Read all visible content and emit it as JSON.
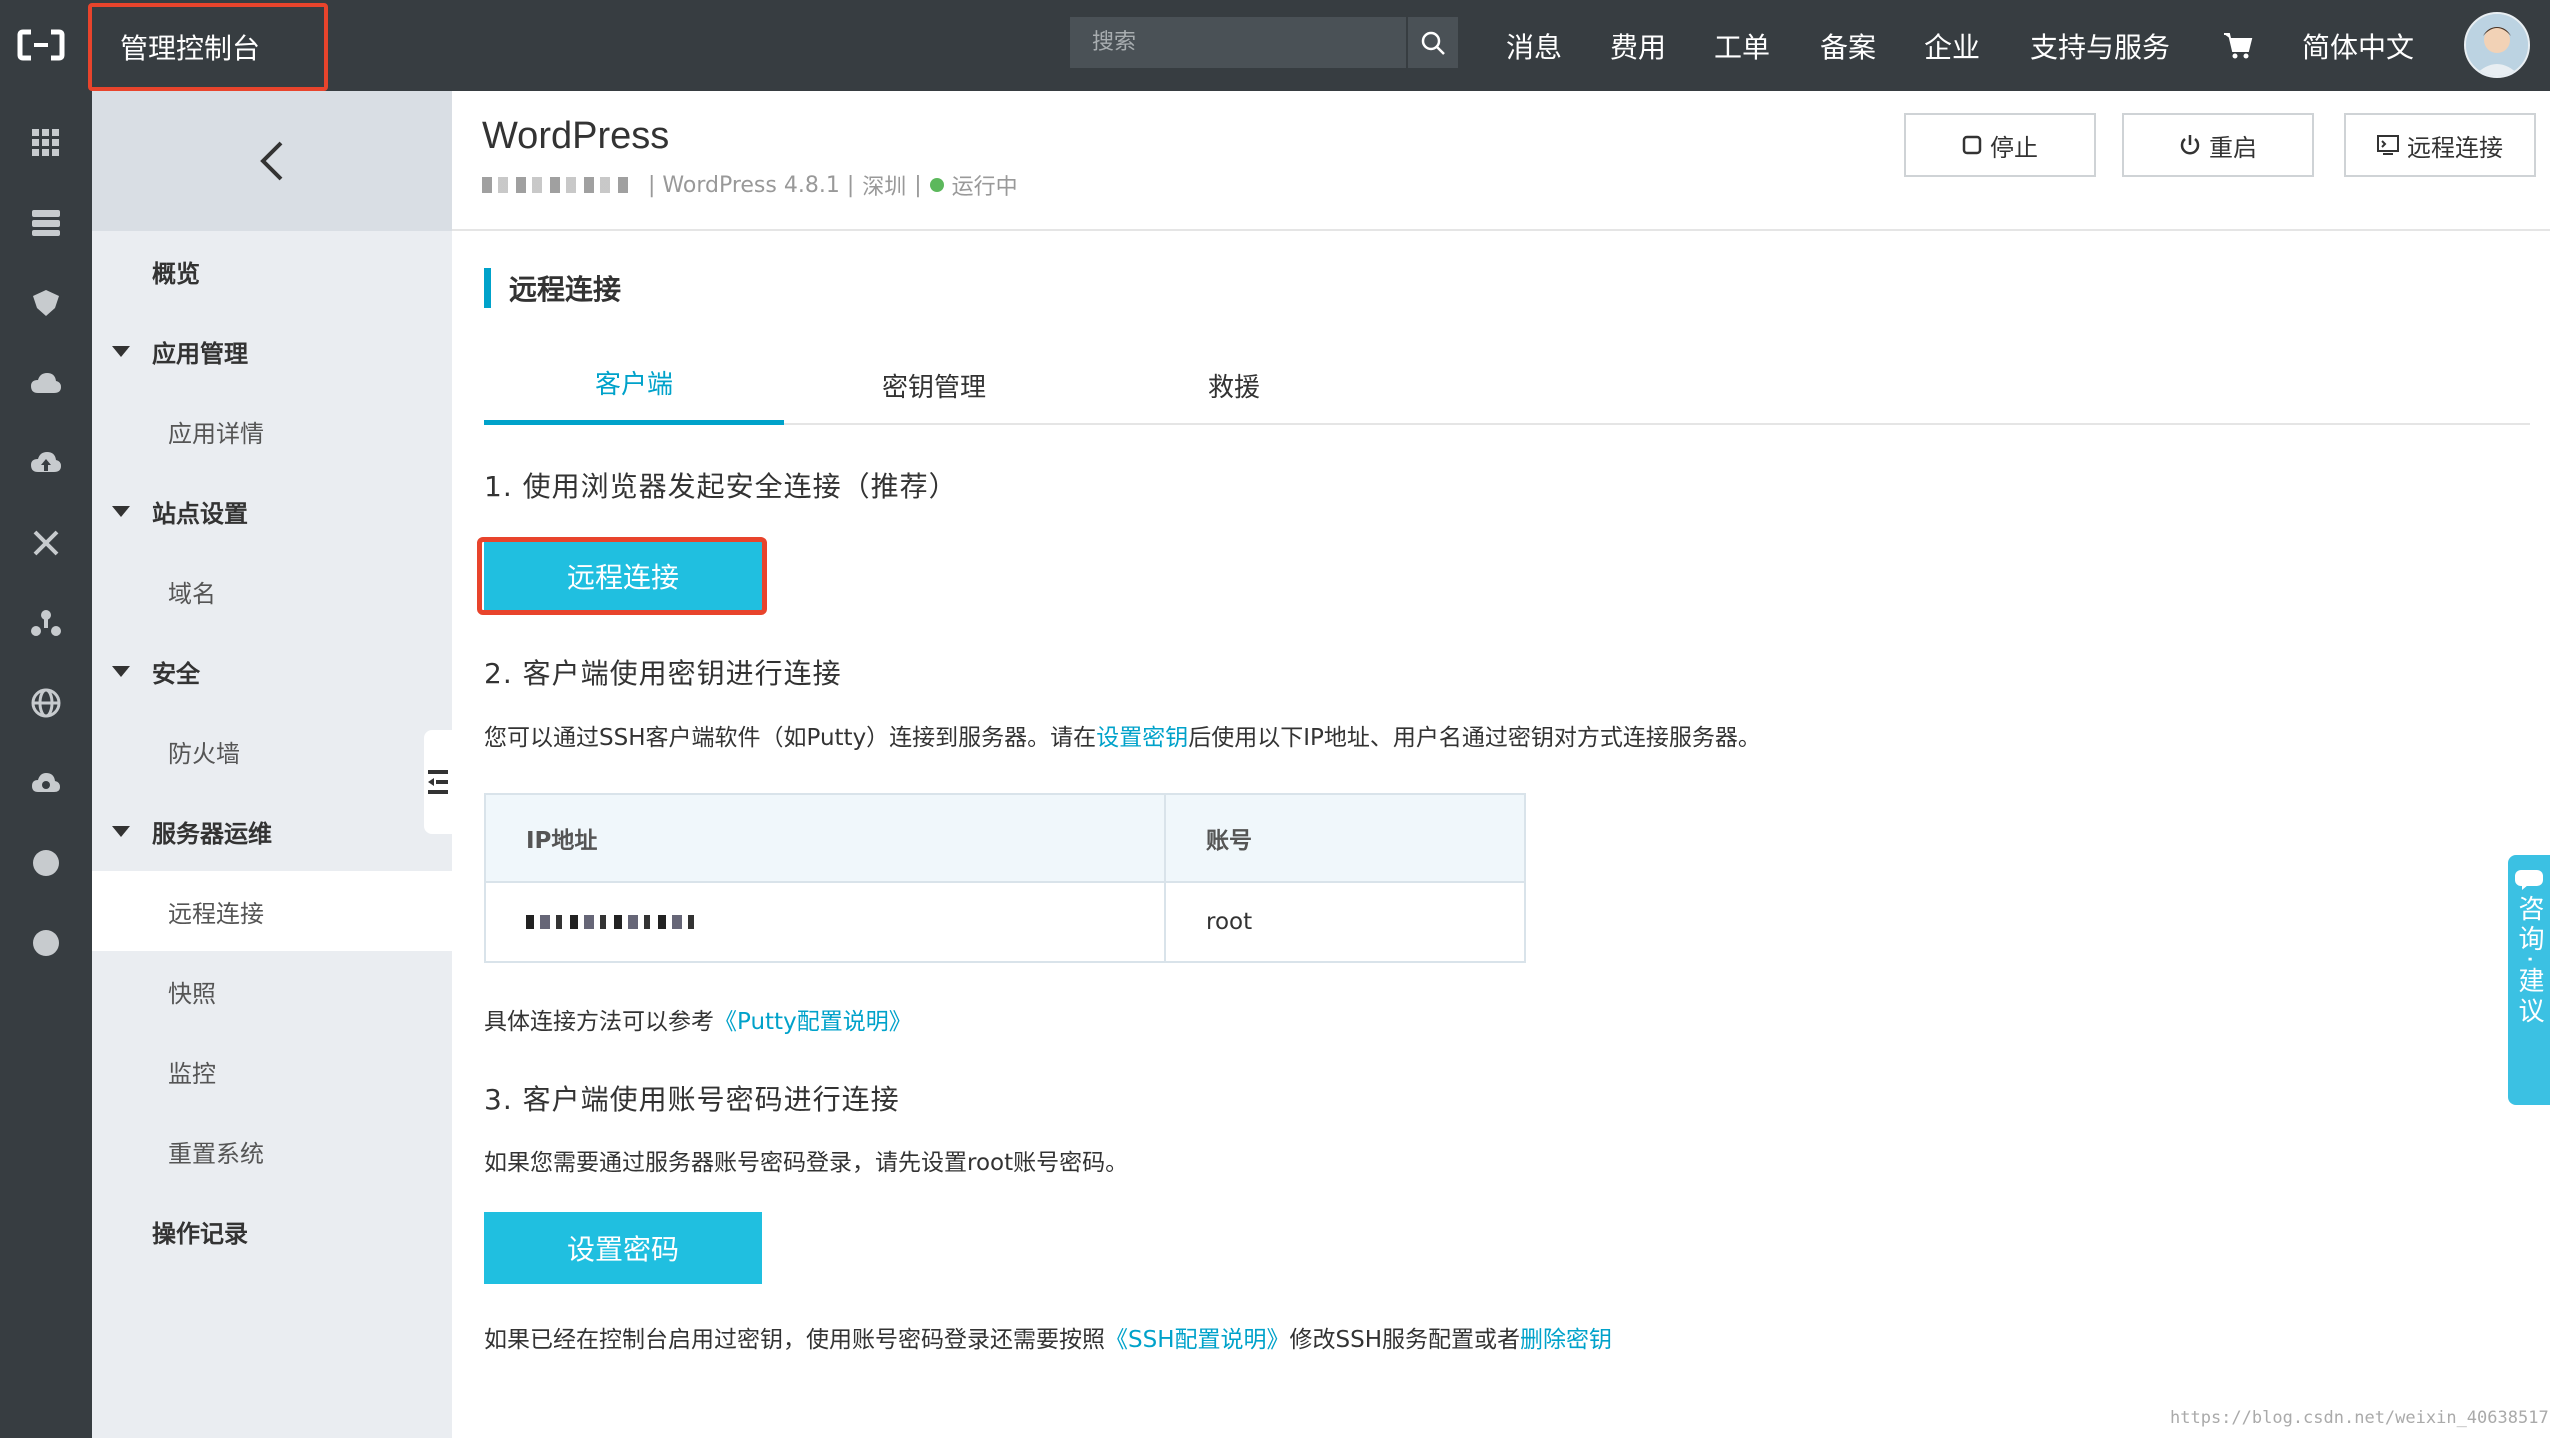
{
  "topbar": {
    "console_title": "管理控制台",
    "search_placeholder": "搜索",
    "nav": [
      "消息",
      "费用",
      "工单",
      "备案",
      "企业",
      "支持与服务",
      "简体中文"
    ]
  },
  "rail_icons": [
    "grid-icon",
    "server-icon",
    "database-icon",
    "cloud-icon",
    "cloud-upload-icon",
    "network-icon",
    "cluster-icon",
    "globe-icon",
    "cloud-sync-icon",
    "circle-icon",
    "circle-icon"
  ],
  "sidebar": {
    "items": [
      {
        "label": "概览",
        "type": "plain"
      },
      {
        "label": "应用管理",
        "type": "group"
      },
      {
        "label": "应用详情",
        "type": "sub"
      },
      {
        "label": "站点设置",
        "type": "group"
      },
      {
        "label": "域名",
        "type": "sub"
      },
      {
        "label": "安全",
        "type": "group"
      },
      {
        "label": "防火墙",
        "type": "sub"
      },
      {
        "label": "服务器运维",
        "type": "group"
      },
      {
        "label": "远程连接",
        "type": "sub",
        "active": true
      },
      {
        "label": "快照",
        "type": "sub"
      },
      {
        "label": "监控",
        "type": "sub"
      },
      {
        "label": "重置系统",
        "type": "sub"
      },
      {
        "label": "操作记录",
        "type": "plain"
      }
    ]
  },
  "header": {
    "title": "WordPress",
    "version": "| WordPress 4.8.1 |",
    "region": "深圳",
    "separator": "|",
    "status": "运行中",
    "buttons": {
      "stop": "停止",
      "restart": "重启",
      "remote": "远程连接"
    }
  },
  "content": {
    "section_title": "远程连接",
    "tabs": [
      "客户端",
      "密钥管理",
      "救援"
    ],
    "step1": "1. 使用浏览器发起安全连接（推荐）",
    "remote_button": "远程连接",
    "step2": "2. 客户端使用密钥进行连接",
    "desc2_a": "您可以通过SSH客户端软件（如Putty）连接到服务器。请在",
    "desc2_link": "设置密钥",
    "desc2_b": "后使用以下IP地址、用户名通过密钥对方式连接服务器。",
    "table": {
      "headers": [
        "IP地址",
        "账号"
      ],
      "account": "root"
    },
    "ref_text": "具体连接方法可以参考",
    "ref_link": "《Putty配置说明》",
    "step3": "3. 客户端使用账号密码进行连接",
    "desc3": "如果您需要通过服务器账号密码登录，请先设置root账号密码。",
    "set_password_button": "设置密码",
    "footer_a": "如果已经在控制台启用过密钥，使用账号密码登录还需要按照",
    "footer_link1": "《SSH配置说明》",
    "footer_b": "修改SSH服务配置或者",
    "footer_link2": "删除密钥"
  },
  "consult": "咨询·建议",
  "watermark": "https://blog.csdn.net/weixin_40638517",
  "colors": {
    "topbar": "#373d41",
    "accent": "#00a2ca",
    "button": "#20bfe0",
    "highlight": "#e8442c",
    "status": "#5cb85c"
  }
}
